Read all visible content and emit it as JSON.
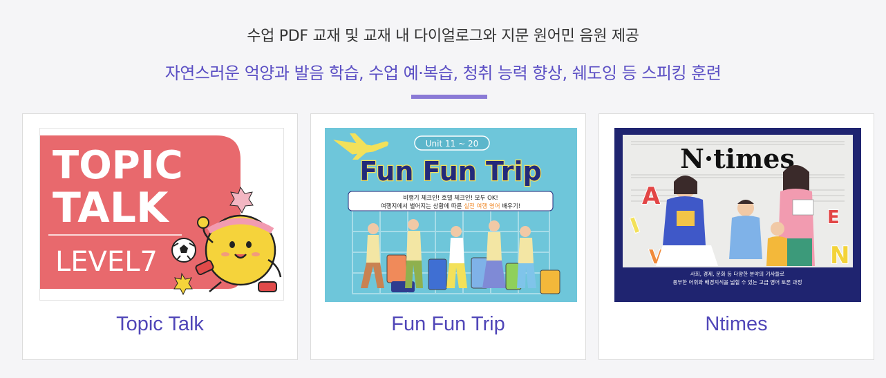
{
  "header": {
    "headline": "수업 PDF 교재 및 교재 내  다이얼로그와 지문 원어민 음원 제공",
    "subline": "자연스러운 억양과 발음 학습, 수업 예·복습, 청취 능력 향상, 쉐도잉 등 스피킹 훈련"
  },
  "cards": [
    {
      "title": "Topic Talk",
      "thumb": {
        "line1": "TOPIC",
        "line2": "TALK",
        "line3": "LEVEL7"
      },
      "colors": {
        "bg": "#e8696d",
        "accent": "#f5d33b"
      }
    },
    {
      "title": "Fun Fun Trip",
      "thumb": {
        "unit": "Unit 11 ~ 20",
        "logo": "Fun Fun Trip",
        "desc1": "비행기 체크인! 호텔 체크인! 모두 OK!",
        "desc2a": "여행지에서 벌어지는 상황에 따른 ",
        "desc2b": "실전 여행 영어",
        "desc2c": " 배우기!"
      },
      "colors": {
        "bg": "#6ec6da",
        "accent": "#f3e15a"
      }
    },
    {
      "title": "Ntimes",
      "thumb": {
        "logo": "N·times",
        "caption1": "사회, 경제, 문화 등 다양한 분야의 기사들로",
        "caption2": "풍부한 어휘와 배경지식을 넓힐 수 있는 고급 영어 토론 과정"
      },
      "colors": {
        "frame": "#1f2470",
        "paper": "#ececea"
      }
    }
  ]
}
